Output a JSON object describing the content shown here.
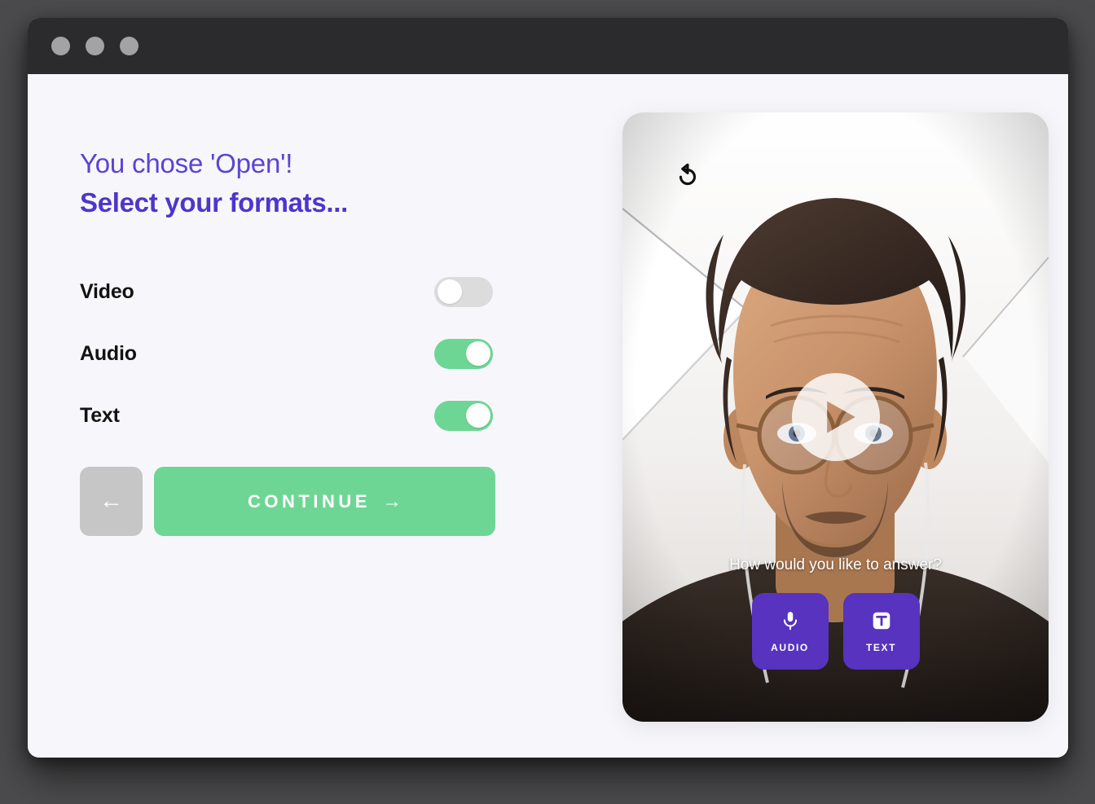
{
  "window": {
    "traffic_lights": [
      "close",
      "minimize",
      "maximize"
    ],
    "titlebar_color": "#2b2b2d",
    "page_background": "#f7f7fb",
    "desktop_background": "#4b4b4d"
  },
  "left": {
    "headline_1": "You chose 'Open'!",
    "headline_2": "Select your formats...",
    "headline_color": "#4f35cc",
    "formats": [
      {
        "label": "Video",
        "enabled": false
      },
      {
        "label": "Audio",
        "enabled": true
      },
      {
        "label": "Text",
        "enabled": true
      }
    ],
    "back_button": {
      "icon": "arrow-left-icon",
      "glyph": "←"
    },
    "continue_button": {
      "label": "CONTINUE",
      "arrow": "→",
      "color": "#6ed694"
    },
    "toggle_on_color": "#6ed694",
    "toggle_off_color": "#dcdcdc"
  },
  "preview": {
    "replay_icon": "replay-icon",
    "play_icon": "play-icon",
    "prompt": "How would you like to answer?",
    "choices": [
      {
        "label": "AUDIO",
        "icon": "microphone-icon"
      },
      {
        "label": "TEXT",
        "icon": "text-format-icon"
      }
    ],
    "choice_color": "#5733bf"
  }
}
